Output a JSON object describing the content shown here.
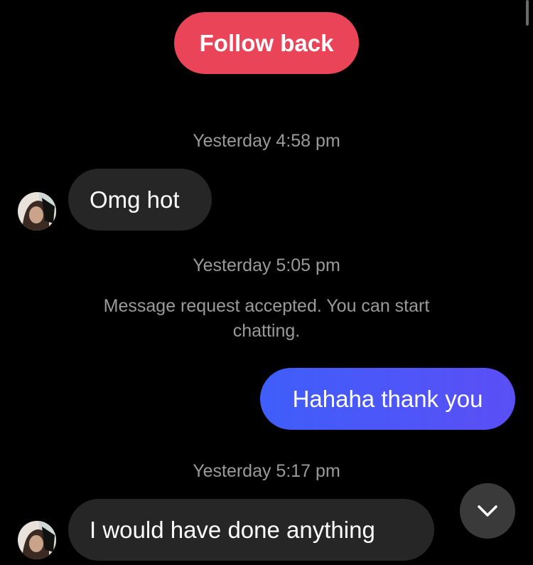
{
  "header": {
    "follow_back_label": "Follow back"
  },
  "messages": [
    {
      "type": "timestamp",
      "text": "Yesterday 4:58 pm"
    },
    {
      "type": "incoming",
      "text": "Omg hot"
    },
    {
      "type": "timestamp",
      "text": "Yesterday 5:05 pm"
    },
    {
      "type": "system",
      "text": "Message request accepted. You can start chatting."
    },
    {
      "type": "outgoing",
      "text": "Hahaha thank you"
    },
    {
      "type": "timestamp",
      "text": "Yesterday 5:17 pm"
    },
    {
      "type": "incoming",
      "text": "I would have done anything"
    }
  ],
  "icons": {
    "scroll_down": "chevron-down-icon",
    "avatar": "avatar"
  },
  "colors": {
    "background": "#000000",
    "follow_back": "#ea4458",
    "incoming_bubble": "#262626",
    "outgoing_bubble_start": "#3f5efb",
    "outgoing_bubble_end": "#5a4ff5",
    "meta_text": "#9a9a9a"
  }
}
